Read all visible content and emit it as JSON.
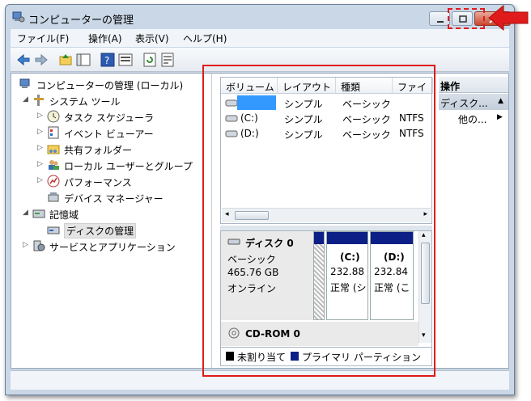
{
  "window": {
    "title": "コンピューターの管理"
  },
  "menu": [
    "ファイル(F)",
    "操作(A)",
    "表示(V)",
    "ヘルプ(H)"
  ],
  "toolbar_icons": [
    "back-icon",
    "forward-icon",
    "up-folder-icon",
    "show-hide-tree-icon",
    "help-icon",
    "properties-icon",
    "refresh-icon",
    "export-icon"
  ],
  "tree": {
    "root": "コンピューターの管理 (ローカル)",
    "system_tools": "システム ツール",
    "task_scheduler": "タスク スケジューラ",
    "event_viewer": "イベント ビューアー",
    "shared_folders": "共有フォルダー",
    "local_users": "ローカル ユーザーとグループ",
    "performance": "パフォーマンス",
    "device_manager": "デバイス マネージャー",
    "storage": "記憶域",
    "disk_management": "ディスクの管理",
    "services_apps": "サービスとアプリケーション"
  },
  "volume_list": {
    "columns": [
      "ボリューム",
      "レイアウト",
      "種類",
      "ファイ"
    ],
    "rows": [
      {
        "volume": "",
        "layout": "シンプル",
        "type": "ベーシック",
        "fs": ""
      },
      {
        "volume": "(C:)",
        "layout": "シンプル",
        "type": "ベーシック",
        "fs": "NTFS"
      },
      {
        "volume": "(D:)",
        "layout": "シンプル",
        "type": "ベーシック",
        "fs": "NTFS"
      }
    ]
  },
  "disk0": {
    "name": "ディスク 0",
    "type": "ベーシック",
    "size": "465.76 GB",
    "status": "オンライン",
    "partitions": [
      {
        "label": "(C:)",
        "size": "232.88",
        "status": "正常 (シ"
      },
      {
        "label": "(D:)",
        "size": "232.84",
        "status": "正常 (こ"
      }
    ]
  },
  "cdrom0": {
    "name": "CD-ROM 0"
  },
  "legend": {
    "unallocated": "未割り当て",
    "primary": "プライマリ パーティション"
  },
  "actions": {
    "header": "操作",
    "section": "ディスク...",
    "more": "他の..."
  },
  "colors": {
    "primary_partition": "#0b1f86",
    "highlight": "#e01b1b",
    "selected_volume": "#3399ff"
  }
}
